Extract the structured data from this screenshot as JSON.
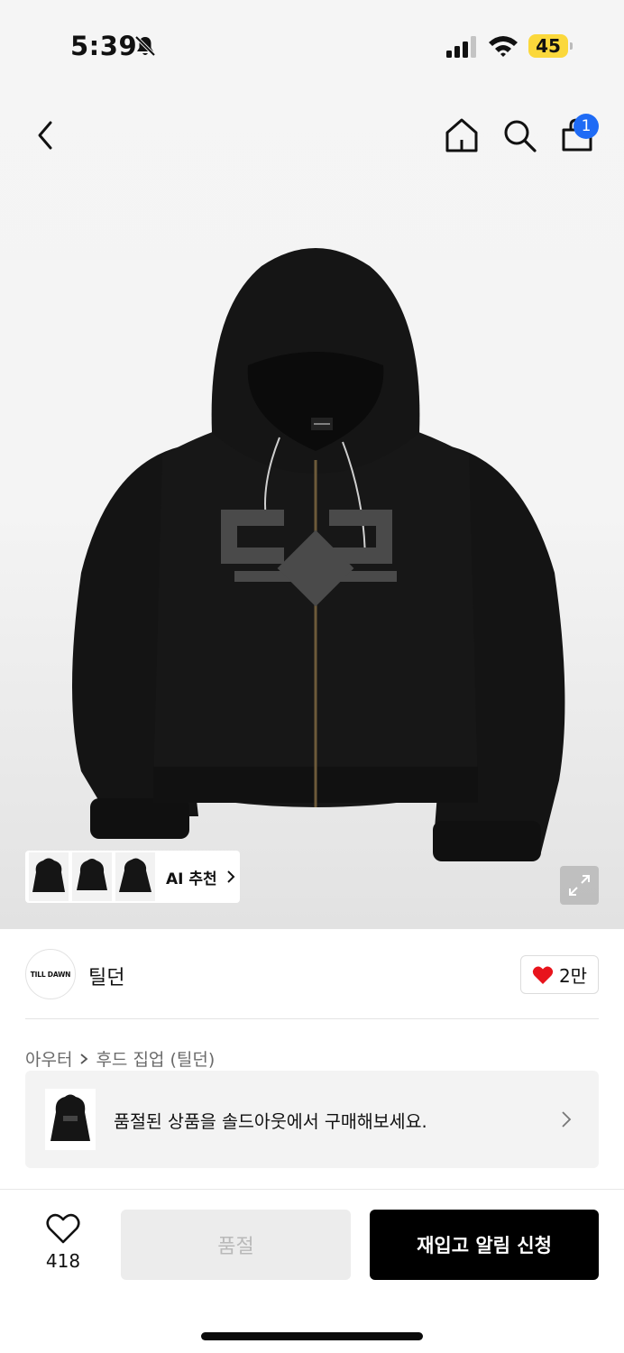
{
  "status_bar": {
    "time": "5:39",
    "battery": "45",
    "battery_color": "#fbd83b"
  },
  "nav": {
    "back_icon": "chevron-left-icon",
    "home_icon": "home-icon",
    "search_icon": "search-icon",
    "bag_icon": "shopping-bag-icon",
    "cart_count": "1",
    "badge_color": "#1f6bf5"
  },
  "ai_recommend": {
    "label": "AI 추천",
    "thumbnail_count": 3
  },
  "brand": {
    "logo_text": "TILL DAWN",
    "name": "틸던",
    "like_count": "2만",
    "heart_color": "#e8141c"
  },
  "breadcrumb": {
    "category": "아우터",
    "subcategory": "후드 집업 (틸던)"
  },
  "soldout_banner": {
    "text": "품절된 상품을 솔드아웃에서 구매해보세요."
  },
  "action_bar": {
    "wish_count": "418",
    "soldout_label": "품절",
    "restock_label": "재입고 알림 신청"
  }
}
